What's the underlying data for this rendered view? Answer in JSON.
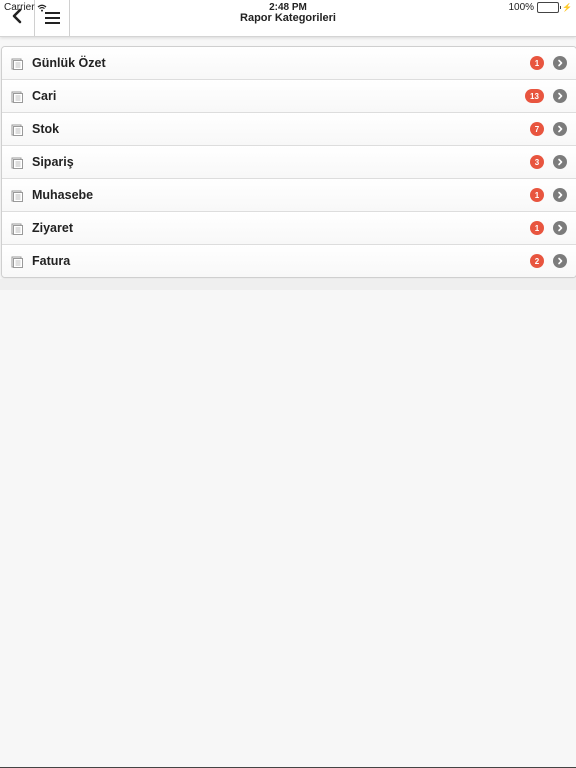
{
  "status_bar": {
    "carrier": "Carrier",
    "time": "2:48 PM",
    "battery_percent": "100%",
    "battery_level": 1.0,
    "battery_color": "#4cd964"
  },
  "header": {
    "title": "Rapor Kategorileri",
    "back_icon": "chevron-left-icon",
    "menu_icon": "hamburger-menu-icon"
  },
  "colors": {
    "badge": "#e8553f",
    "arrow": "#7c7c7c"
  },
  "categories": [
    {
      "label": "Günlük Özet",
      "count": "1"
    },
    {
      "label": "Cari",
      "count": "13"
    },
    {
      "label": "Stok",
      "count": "7"
    },
    {
      "label": "Sipariş",
      "count": "3"
    },
    {
      "label": "Muhasebe",
      "count": "1"
    },
    {
      "label": "Ziyaret",
      "count": "1"
    },
    {
      "label": "Fatura",
      "count": "2"
    }
  ]
}
